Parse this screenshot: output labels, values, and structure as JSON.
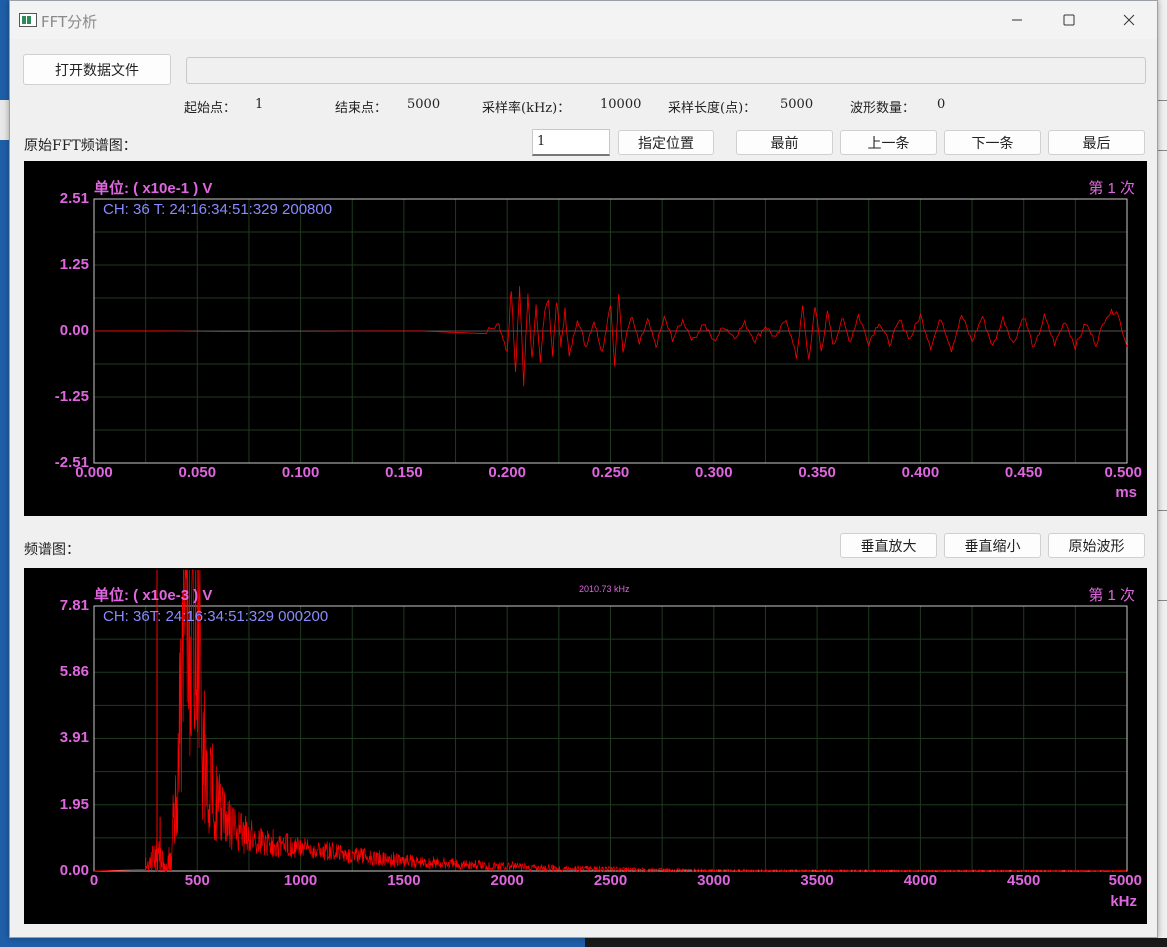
{
  "window": {
    "title": "FFT分析",
    "minimize_icon": "minimize-icon",
    "maximize_icon": "maximize-icon",
    "close_icon": "close-icon"
  },
  "toolbar": {
    "open_file_label": "打开数据文件",
    "file_path": ""
  },
  "info": {
    "start_label": "起始点：",
    "start_value": "1",
    "end_label": "结束点：",
    "end_value": "5000",
    "rate_label": "采样率(kHz)：",
    "rate_value": "10000",
    "length_label": "采样长度(点)：",
    "length_value": "5000",
    "count_label": "波形数量：",
    "count_value": "0"
  },
  "waveform_section": {
    "label": "原始FFT频谱图：",
    "position_value": "1",
    "goto_label": "指定位置",
    "first_label": "最前",
    "prev_label": "上一条",
    "next_label": "下一条",
    "last_label": "最后"
  },
  "spectrum_section": {
    "label": "频谱图：",
    "zoom_in_label": "垂直放大",
    "zoom_out_label": "垂直缩小",
    "original_label": "原始波形"
  },
  "colors": {
    "trace": "#ff0000",
    "label": "#e066e0",
    "info": "#8a8aff",
    "grid": "#1f3a1f",
    "plot_bg": "#000000"
  },
  "chart_data": [
    {
      "type": "line",
      "title": "",
      "unit_label": "单位: ( x10e-1 ) V",
      "count_label": "第 1 次",
      "info_label": "CH: 36  T: 24:16:34:51:329 200800",
      "xlabel": "ms",
      "ylabel": "",
      "xlim": [
        0,
        0.5
      ],
      "ylim": [
        -2.51,
        2.51
      ],
      "xticks": [
        "0.000",
        "0.050",
        "0.100",
        "0.150",
        "0.200",
        "0.250",
        "0.300",
        "0.350",
        "0.400",
        "0.450",
        "0.500"
      ],
      "yticks": [
        "2.51",
        "1.25",
        "0.00",
        "-1.25",
        "-2.51"
      ],
      "grid": true,
      "series": [
        {
          "x": [
            0.0,
            0.19,
            0.196,
            0.2,
            0.202,
            0.204,
            0.206,
            0.208,
            0.21,
            0.212,
            0.214,
            0.216,
            0.218,
            0.22,
            0.222,
            0.224,
            0.226,
            0.228,
            0.23,
            0.234,
            0.238,
            0.242,
            0.246,
            0.25,
            0.252,
            0.254,
            0.256,
            0.26,
            0.264,
            0.268,
            0.272,
            0.276,
            0.28,
            0.285,
            0.29,
            0.295,
            0.3,
            0.305,
            0.31,
            0.315,
            0.32,
            0.325,
            0.33,
            0.335,
            0.34,
            0.343,
            0.346,
            0.349,
            0.352,
            0.355,
            0.358,
            0.362,
            0.366,
            0.37,
            0.375,
            0.38,
            0.385,
            0.39,
            0.395,
            0.4,
            0.405,
            0.41,
            0.415,
            0.42,
            0.425,
            0.43,
            0.435,
            0.44,
            0.445,
            0.45,
            0.455,
            0.46,
            0.465,
            0.47,
            0.475,
            0.48,
            0.485,
            0.49,
            0.495,
            0.5
          ],
          "y": [
            0.0,
            0.0,
            0.12,
            -0.4,
            0.8,
            -0.8,
            0.85,
            -1.0,
            0.7,
            -0.5,
            0.45,
            -0.6,
            0.35,
            0.55,
            -0.45,
            0.6,
            -0.3,
            0.4,
            -0.5,
            0.25,
            -0.3,
            0.2,
            -0.4,
            0.55,
            -0.7,
            0.75,
            -0.4,
            0.3,
            -0.25,
            0.2,
            -0.3,
            0.25,
            -0.15,
            0.2,
            -0.18,
            0.15,
            -0.2,
            0.1,
            -0.12,
            0.15,
            -0.18,
            0.1,
            -0.15,
            0.25,
            -0.5,
            0.45,
            -0.6,
            0.5,
            -0.4,
            0.35,
            -0.3,
            0.25,
            -0.2,
            0.3,
            -0.22,
            0.18,
            -0.25,
            0.2,
            -0.15,
            0.3,
            -0.3,
            0.25,
            -0.35,
            0.3,
            -0.2,
            0.28,
            -0.3,
            0.25,
            -0.25,
            0.3,
            -0.35,
            0.28,
            -0.25,
            0.2,
            -0.3,
            0.15,
            -0.25,
            0.3,
            0.4,
            -0.3
          ]
        }
      ]
    },
    {
      "type": "line",
      "title": "",
      "unit_label": "单位: ( x10e-3 ) V",
      "count_label": "第 1 次",
      "info_label": "CH: 36T: 24:16:34:51:329 000200",
      "peak_label": "2010.73 kHz",
      "xlabel": "kHz",
      "ylabel": "",
      "xlim": [
        0,
        5000
      ],
      "ylim": [
        0,
        7.81
      ],
      "xticks": [
        "0",
        "500",
        "1000",
        "1500",
        "2000",
        "2500",
        "3000",
        "3500",
        "4000",
        "4500",
        "5000"
      ],
      "yticks": [
        "7.81",
        "5.86",
        "3.91",
        "1.95",
        "0.00"
      ],
      "grid": true,
      "series": [
        {
          "x": [
            0,
            250,
            300,
            350,
            400,
            420,
            440,
            460,
            480,
            500,
            520,
            540,
            560,
            600,
            650,
            700,
            800,
            900,
            1000,
            1200,
            1400,
            1600,
            1800,
            2000,
            2200,
            2400,
            2600,
            2800,
            3000,
            3500,
            4000,
            4500,
            5000
          ],
          "y": [
            0,
            0.05,
            1.2,
            0.3,
            2.0,
            5.0,
            7.5,
            7.81,
            7.81,
            7.81,
            6.5,
            5.0,
            4.2,
            3.0,
            2.2,
            1.8,
            1.4,
            1.2,
            1.0,
            0.8,
            0.6,
            0.45,
            0.35,
            0.28,
            0.2,
            0.15,
            0.1,
            0.08,
            0.05,
            0.04,
            0.03,
            0.03,
            0.02
          ],
          "amplitude_band": [
            0,
            0,
            1.2,
            0.3,
            1.5,
            3.0,
            4.0,
            4.0,
            4.0,
            4.0,
            3.2,
            2.4,
            2.0,
            1.4,
            1.0,
            0.8,
            0.6,
            0.5,
            0.4,
            0.35,
            0.3,
            0.25,
            0.2,
            0.18,
            0.14,
            0.1,
            0.08,
            0.06,
            0.05,
            0.04,
            0.03,
            0.03,
            0.02
          ]
        }
      ]
    }
  ]
}
